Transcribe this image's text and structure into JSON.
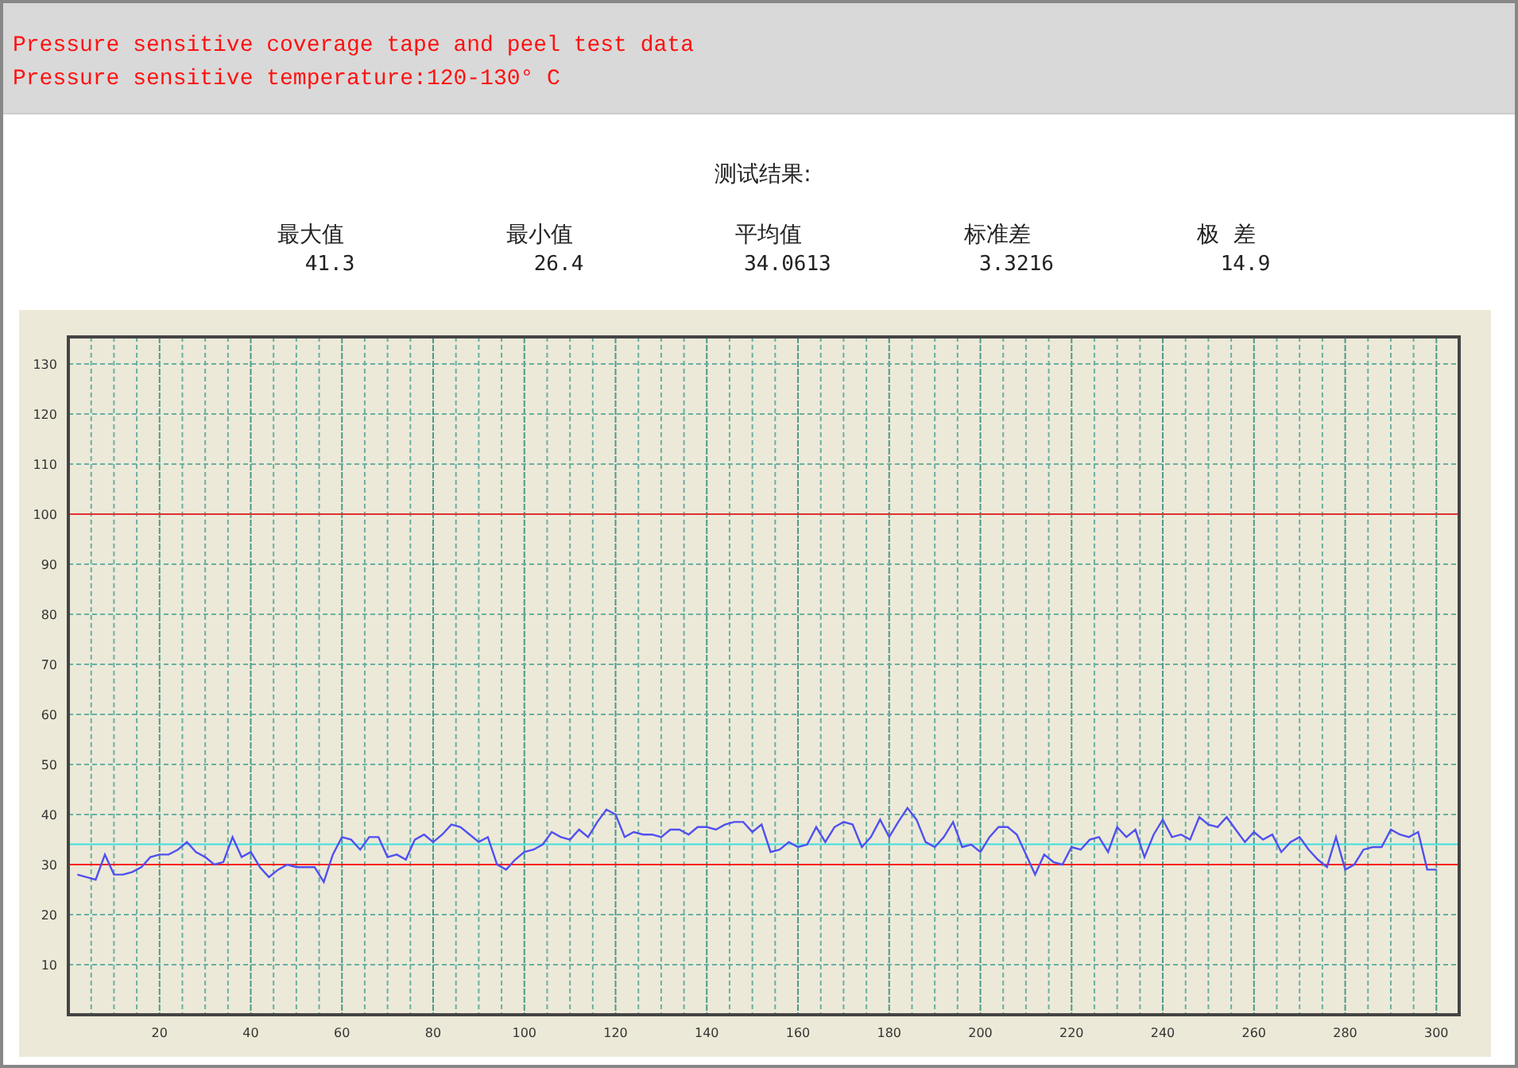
{
  "header": {
    "lines": [
      "Pressure sensitive coverage tape and peel test data",
      "Pressure sensitive temperature:120-130° C"
    ]
  },
  "results": {
    "title": "测试结果:",
    "stats": [
      {
        "label": "最大值",
        "value": "41.3"
      },
      {
        "label": "最小值",
        "value": "26.4"
      },
      {
        "label": "平均值",
        "value": "34.0613"
      },
      {
        "label": "标准差",
        "value": "3.3216"
      },
      {
        "label": "极  差",
        "value": "14.9"
      }
    ]
  },
  "chart": {
    "chart_data": {
      "type": "line",
      "xlim": [
        0,
        305
      ],
      "ylim": [
        0,
        135.4
      ],
      "xticks": [
        20,
        40,
        60,
        80,
        100,
        120,
        140,
        160,
        180,
        200,
        220,
        240,
        260,
        280,
        300
      ],
      "yticks": [
        10,
        20,
        30,
        40,
        50,
        60,
        70,
        80,
        90,
        100,
        110,
        120,
        130
      ],
      "x": [
        2,
        4,
        6,
        8,
        10,
        12,
        14,
        16,
        18,
        20,
        22,
        24,
        26,
        28,
        30,
        32,
        34,
        36,
        38,
        40,
        42,
        44,
        46,
        48,
        50,
        52,
        54,
        56,
        58,
        60,
        62,
        64,
        66,
        68,
        70,
        72,
        74,
        76,
        78,
        80,
        82,
        84,
        86,
        88,
        90,
        92,
        94,
        96,
        98,
        100,
        102,
        104,
        106,
        108,
        110,
        112,
        114,
        116,
        118,
        120,
        122,
        124,
        126,
        128,
        130,
        132,
        134,
        136,
        138,
        140,
        142,
        144,
        146,
        148,
        150,
        152,
        154,
        156,
        158,
        160,
        162,
        164,
        166,
        168,
        170,
        172,
        174,
        176,
        178,
        180,
        182,
        184,
        186,
        188,
        190,
        192,
        194,
        196,
        198,
        200,
        202,
        204,
        206,
        208,
        210,
        212,
        214,
        216,
        218,
        220,
        222,
        224,
        226,
        228,
        230,
        232,
        234,
        236,
        238,
        240,
        242,
        244,
        246,
        248,
        250,
        252,
        254,
        256,
        258,
        260,
        262,
        264,
        266,
        268,
        270,
        272,
        274,
        276,
        278,
        280,
        282,
        284,
        286,
        288,
        290,
        292,
        294,
        296,
        298,
        300
      ],
      "series": [
        {
          "color": "#5050f0",
          "values": [
            28,
            27.5,
            27,
            32,
            28,
            28,
            28.5,
            29.5,
            31.5,
            32,
            32,
            33,
            34.5,
            32.5,
            31.5,
            30,
            30.5,
            35.5,
            31.5,
            32.5,
            29.5,
            27.5,
            29,
            30,
            29.5,
            29.5,
            29.5,
            26.5,
            32,
            35.5,
            35,
            33,
            35.5,
            35.5,
            31.5,
            32,
            31,
            35,
            36,
            34.5,
            36,
            38,
            37.5,
            36,
            34.5,
            35.5,
            30,
            29,
            31,
            32.5,
            33,
            34,
            36.5,
            35.5,
            35,
            37,
            35.5,
            38.5,
            41,
            40,
            35.5,
            36.5,
            36,
            36,
            35.5,
            37,
            37,
            36,
            37.5,
            37.5,
            37,
            38,
            38.5,
            38.5,
            36.5,
            38,
            32.5,
            33,
            34.5,
            33.5,
            34,
            37.5,
            34.5,
            37.5,
            38.5,
            38,
            33.5,
            35.5,
            39,
            35.5,
            38.5,
            41.3,
            39,
            34.5,
            33.5,
            35.5,
            38.5,
            33.5,
            34,
            32.5,
            35.5,
            37.5,
            37.5,
            36,
            32,
            28,
            32,
            30.5,
            30,
            33.5,
            33,
            35,
            35.5,
            32.5,
            37.5,
            35.5,
            37,
            31.5,
            36,
            39,
            35.5,
            36,
            35,
            39.5,
            38,
            37.5,
            39.5,
            37,
            34.5,
            36.5,
            35,
            36,
            32.5,
            34.5,
            35.5,
            33,
            31,
            29.5,
            35.5,
            29,
            30,
            33,
            33.5,
            33.5,
            37,
            36,
            35.5,
            36.5,
            29,
            29
          ]
        }
      ],
      "grid": true,
      "ref_lines": [
        {
          "axis": "y",
          "value": 100,
          "color": "#e03030"
        },
        {
          "axis": "y",
          "value": 30,
          "color": "#ff2020"
        },
        {
          "axis": "y",
          "value": 34.0613,
          "color": "#40e0e0"
        }
      ]
    }
  }
}
